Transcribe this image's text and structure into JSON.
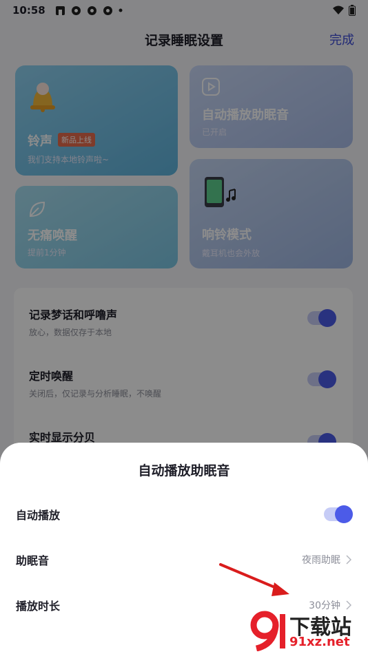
{
  "status_bar": {
    "time": "10:58"
  },
  "header": {
    "title": "记录睡眠设置",
    "done_label": "完成"
  },
  "cards": {
    "ringtone": {
      "title": "铃声",
      "badge": "新品上线",
      "subtitle": "我们支持本地铃声啦~"
    },
    "auto_play": {
      "title": "自动播放助眠音",
      "subtitle": "已开启"
    },
    "painless_wake": {
      "title": "无痛唤醒",
      "subtitle": "提前1分钟"
    },
    "ring_mode": {
      "title": "响铃模式",
      "subtitle": "戴耳机也会外放"
    }
  },
  "settings": [
    {
      "label": "记录梦话和呼噜声",
      "subtitle": "放心，数据仅存于本地",
      "enabled": true
    },
    {
      "label": "定时唤醒",
      "subtitle": "关闭后，仅记录与分析睡眠，不唤醒",
      "enabled": true
    },
    {
      "label": "实时显示分贝",
      "enabled": true
    }
  ],
  "sheet": {
    "title": "自动播放助眠音",
    "auto_play_label": "自动播放",
    "auto_play_enabled": true,
    "sleep_sound_label": "助眠音",
    "sleep_sound_value": "夜雨助眠",
    "duration_label": "播放时长",
    "duration_value": "30分钟"
  },
  "watermark": {
    "text": "下载站",
    "url": "91xz.net"
  },
  "colors": {
    "accent": "#4c5be8",
    "done": "#3c4bd6"
  }
}
